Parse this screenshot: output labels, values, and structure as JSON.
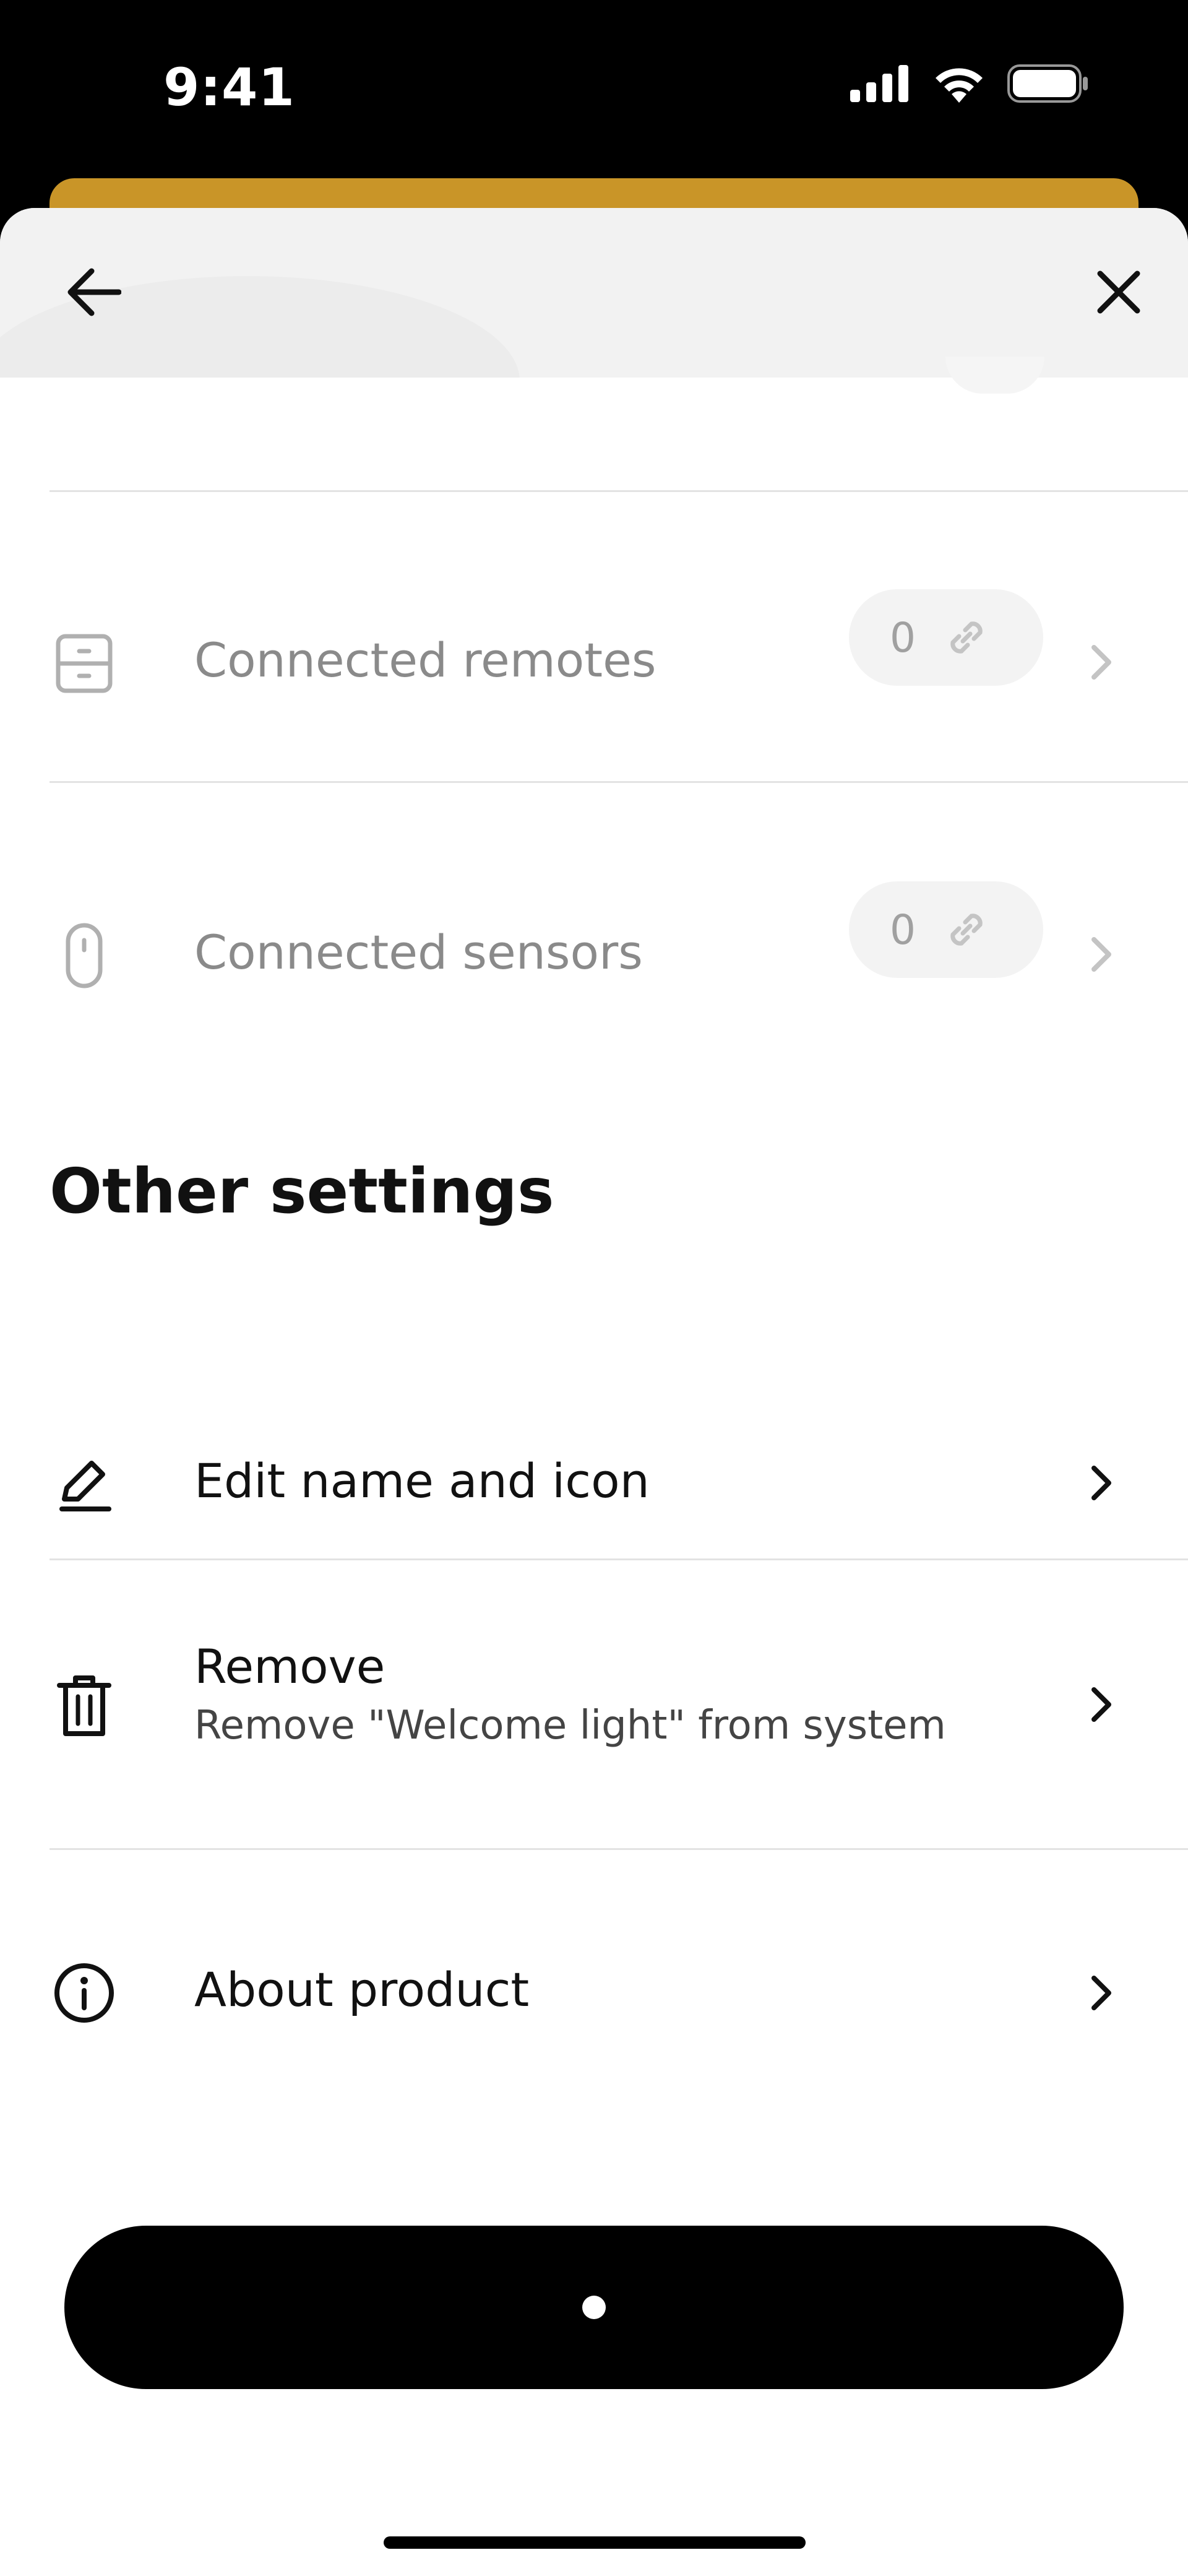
{
  "status_bar": {
    "time": "9:41",
    "icons": [
      "cellular-signal-icon",
      "wifi-icon",
      "battery-icon"
    ]
  },
  "header": {
    "back_icon": "arrow-left-icon",
    "close_icon": "close-icon"
  },
  "connections": [
    {
      "label": "Connected remotes",
      "count": "0",
      "icon": "remote-icon",
      "enabled": false
    },
    {
      "label": "Connected sensors",
      "count": "0",
      "icon": "sensor-icon",
      "enabled": false
    }
  ],
  "other_settings": {
    "title": "Other settings",
    "items": [
      {
        "label": "Edit name and icon",
        "icon": "pencil-icon"
      },
      {
        "label": "Remove",
        "sublabel": "Remove \"Welcome light\" from system",
        "icon": "trash-icon"
      },
      {
        "label": "About product",
        "icon": "info-icon"
      }
    ]
  },
  "primary_button": {
    "state": "loading"
  },
  "colors": {
    "accent_sheet": "#c99528",
    "text_primary": "#111111",
    "text_disabled": "#8a8a8a",
    "button": "#000000"
  }
}
